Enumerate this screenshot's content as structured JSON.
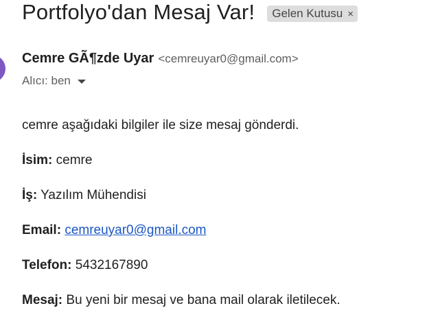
{
  "subject": "Portfolyo'dan Mesaj Var!",
  "label_chip": {
    "text": "Gelen Kutusu",
    "close_glyph": "×"
  },
  "sender": {
    "name": "Cemre GÃ¶zde Uyar",
    "email": "<cemreuyar0@gmail.com>",
    "avatar_color": "#7e57c2"
  },
  "recipient": {
    "label": "Alıcı: ben",
    "icon": "caret-down-icon"
  },
  "body": {
    "intro": "cemre aşağıdaki bilgiler ile size mesaj gönderdi.",
    "fields": [
      {
        "label": "İsim:",
        "value": "cemre"
      },
      {
        "label": "İş:",
        "value": "Yazılım Mühendisi"
      },
      {
        "label": "Email:",
        "value": "cemreuyar0@gmail.com",
        "is_link": true
      },
      {
        "label": "Telefon:",
        "value": "5432167890"
      },
      {
        "label": "Mesaj:",
        "value": "Bu yeni bir mesaj ve bana mail olarak iletilecek."
      }
    ]
  },
  "colors": {
    "link": "#1a56c4",
    "chip_bg": "#dddddd",
    "text": "#1f1f1f",
    "muted": "#5e5e5e"
  }
}
